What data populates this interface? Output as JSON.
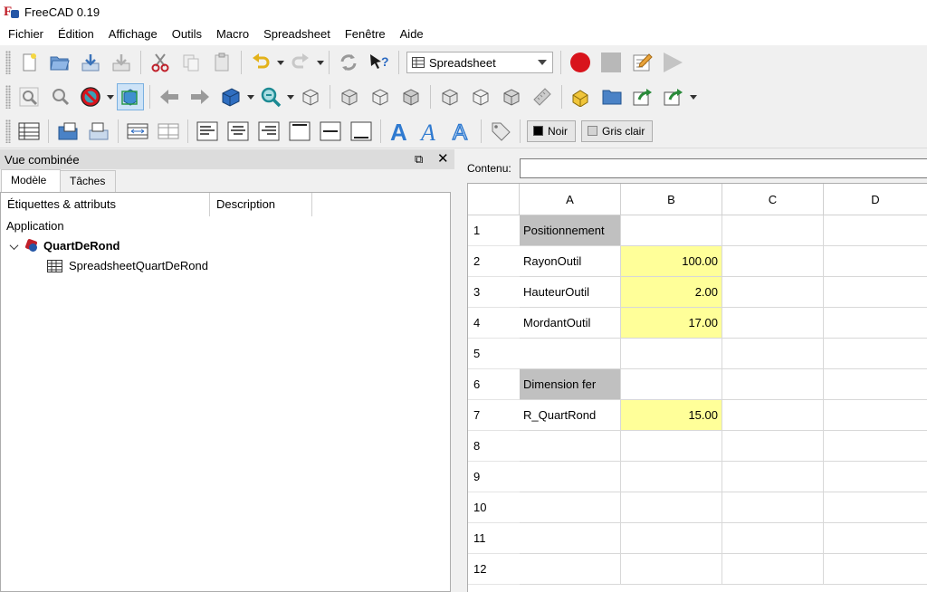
{
  "window": {
    "title": "FreeCAD 0.19"
  },
  "menu": [
    "Fichier",
    "Édition",
    "Affichage",
    "Outils",
    "Macro",
    "Spreadsheet",
    "Fenêtre",
    "Aide"
  ],
  "toolbar": {
    "workbench": "Spreadsheet",
    "color_text": "Noir",
    "color_text_hex": "#000000",
    "color_bg": "Gris clair",
    "color_bg_hex": "#d3d3d3"
  },
  "combo": {
    "title": "Vue combinée",
    "tabs": [
      "Modèle",
      "Tâches"
    ],
    "columns": [
      "Étiquettes & attributs",
      "Description"
    ],
    "application": "Application",
    "document": "QuartDeRond",
    "child": "SpreadsheetQuartDeRond"
  },
  "spreadsheet": {
    "contenu_label": "Contenu:",
    "contenu_value": "",
    "columns": [
      "A",
      "B",
      "C",
      "D"
    ],
    "rows": [
      "1",
      "2",
      "3",
      "4",
      "5",
      "6",
      "7",
      "8",
      "9",
      "10",
      "11",
      "12"
    ],
    "cells": {
      "A1": "Positionnement",
      "A2": "RayonOutil",
      "B2": "100.00",
      "A3": "HauteurOutil",
      "B3": "2.00",
      "A4": "MordantOutil",
      "B4": "17.00",
      "A6": "Dimension fer",
      "A7": "R_QuartRond",
      "B7": "15.00"
    },
    "colors": {
      "header_fill": "#c0c0c0",
      "value_fill": "#ffff99"
    }
  }
}
